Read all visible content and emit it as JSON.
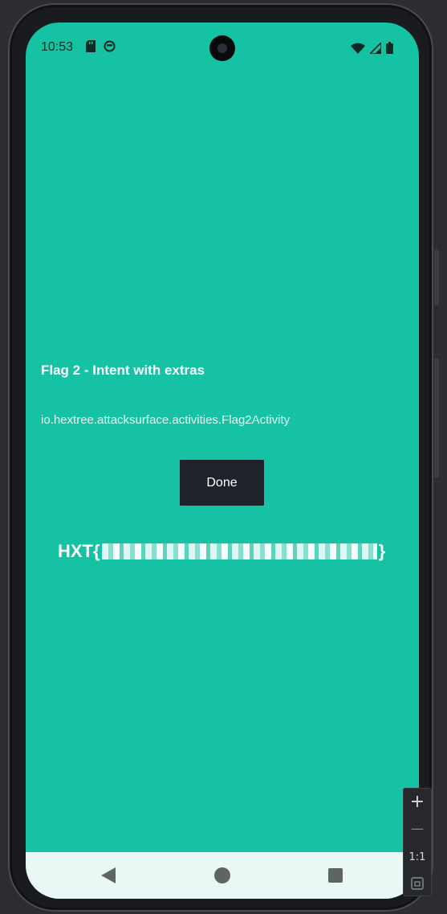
{
  "status_bar": {
    "time": "10:53",
    "left_icons": [
      "sd-card-icon",
      "android-debug-icon"
    ],
    "right_icons": [
      "wifi-icon",
      "cellular-signal-icon",
      "battery-icon"
    ]
  },
  "main": {
    "title": "Flag 2 - Intent with extras",
    "activity": "io.hextree.attacksurface.activities.Flag2Activity",
    "done_label": "Done",
    "flag_prefix": "HXT{",
    "flag_suffix": "}"
  },
  "nav_bar": {
    "icons": [
      "back-icon",
      "home-icon",
      "recents-icon"
    ]
  },
  "zoom_controls": {
    "zoom_in": "+",
    "zoom_out": "—",
    "one_to_one": "1:1",
    "fit_icon": "fit-screen-icon"
  },
  "colors": {
    "screen_background": "#15c2a4",
    "button_background": "#20222b",
    "nav_bar_background": "#e9f8f4"
  }
}
